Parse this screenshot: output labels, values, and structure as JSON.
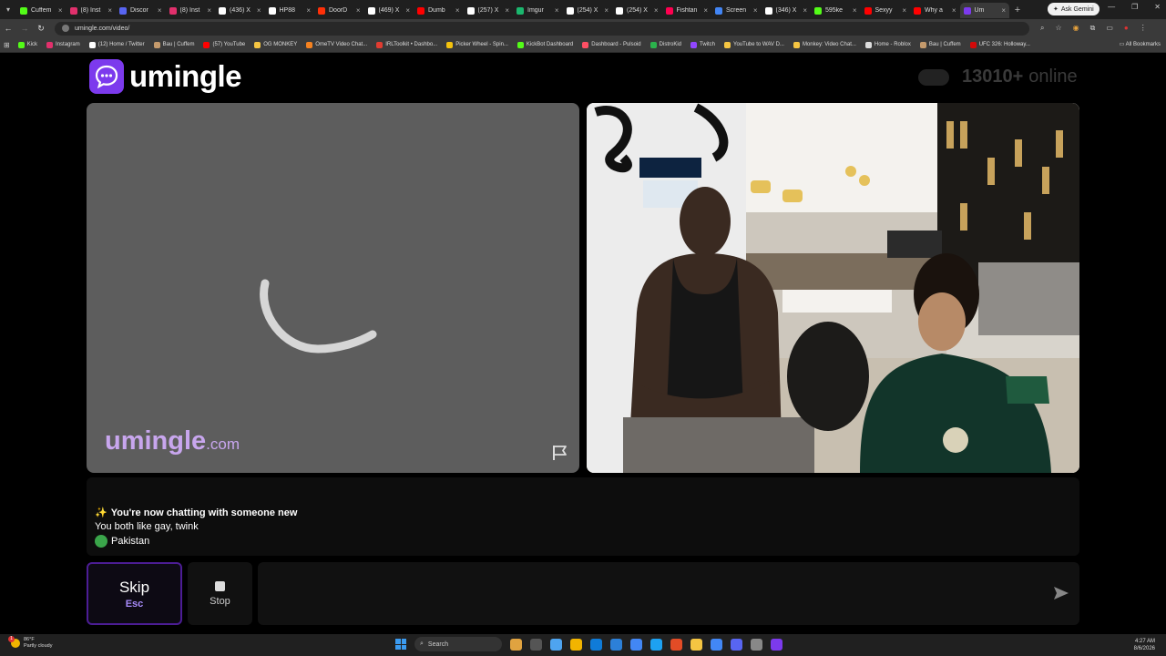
{
  "browser": {
    "tabs": [
      {
        "label": "Cuffem",
        "color": "#53fc18"
      },
      {
        "label": "(8) Inst",
        "color": "#e1306c"
      },
      {
        "label": "Discor",
        "color": "#5865f2"
      },
      {
        "label": "(8) Inst",
        "color": "#e1306c"
      },
      {
        "label": "(436) X",
        "color": "#ffffff"
      },
      {
        "label": "HP88",
        "color": "#ffffff"
      },
      {
        "label": "DoorD",
        "color": "#ff3008"
      },
      {
        "label": "(469) X",
        "color": "#ffffff"
      },
      {
        "label": "Dumb",
        "color": "#ff0000"
      },
      {
        "label": "(257) X",
        "color": "#ffffff"
      },
      {
        "label": "Imgur",
        "color": "#1bb76e"
      },
      {
        "label": "(254) X",
        "color": "#ffffff"
      },
      {
        "label": "(254) X",
        "color": "#ffffff"
      },
      {
        "label": "Fishtan",
        "color": "#ff0050"
      },
      {
        "label": "Screen",
        "color": "#4285f4"
      },
      {
        "label": "(346) X",
        "color": "#ffffff"
      },
      {
        "label": "595ke",
        "color": "#53fc18"
      },
      {
        "label": "Sexyy",
        "color": "#ff0000"
      },
      {
        "label": "Why a",
        "color": "#ff0000"
      },
      {
        "label": "Um",
        "color": "#7c3aed",
        "active": true
      }
    ],
    "new_tab": "+",
    "ask_gemini": "Ask Gemini",
    "url": "umingle.com/video/",
    "bookmarks": [
      {
        "label": "Kick",
        "color": "#53fc18"
      },
      {
        "label": "Instagram",
        "color": "#e1306c"
      },
      {
        "label": "(12) Home / Twitter",
        "color": "#ffffff"
      },
      {
        "label": "Bau | Cuffem",
        "color": "#c49a6c"
      },
      {
        "label": "(57) YouTube",
        "color": "#ff0000"
      },
      {
        "label": "OG MONKEY",
        "color": "#f5c542"
      },
      {
        "label": "OmeTV Video Chat...",
        "color": "#f58220"
      },
      {
        "label": "IRLToolkit • Dashbo...",
        "color": "#e03c31"
      },
      {
        "label": "Picker Wheel - Spin...",
        "color": "#f4c20d"
      },
      {
        "label": "KickBot Dashboard",
        "color": "#53fc18"
      },
      {
        "label": "Dashboard - Pulsoid",
        "color": "#ff4f64"
      },
      {
        "label": "DistroKid",
        "color": "#2bb24c"
      },
      {
        "label": "Twitch",
        "color": "#9146ff"
      },
      {
        "label": "YouTube to WAV D...",
        "color": "#f5c542"
      },
      {
        "label": "Monkey: Video Chat...",
        "color": "#f5c542"
      },
      {
        "label": "Home - Roblox",
        "color": "#dddddd"
      },
      {
        "label": "Bau | Cuffem",
        "color": "#c49a6c"
      },
      {
        "label": "UFC 326: Holloway...",
        "color": "#d20a0a"
      }
    ],
    "all_bookmarks": "All Bookmarks"
  },
  "site": {
    "logo_text": "umingle",
    "online_count": "13010+",
    "online_label": "online",
    "watermark_main": "umingle",
    "watermark_tld": ".com"
  },
  "chat": {
    "system_message": "You're now chatting with someone new",
    "interests": "You both like gay, twink",
    "country": "Pakistan"
  },
  "controls": {
    "skip_label": "Skip",
    "skip_key": "Esc",
    "stop_label": "Stop",
    "message_placeholder": ""
  },
  "taskbar": {
    "weather_temp": "86°F",
    "weather_desc": "Partly cloudy",
    "weather_badge": "1",
    "search_label": "Search",
    "time": "4:27 AM",
    "date": "8/6/2026",
    "apps": [
      "#e0a340",
      "#555555",
      "#4ea4f0",
      "#f2b400",
      "#0f7bd8",
      "#2c80d8",
      "#4287f5",
      "#1da1f2",
      "#e34c26",
      "#f5c542",
      "#4287f5",
      "#5865f2",
      "#888888",
      "#7c3aed"
    ]
  }
}
